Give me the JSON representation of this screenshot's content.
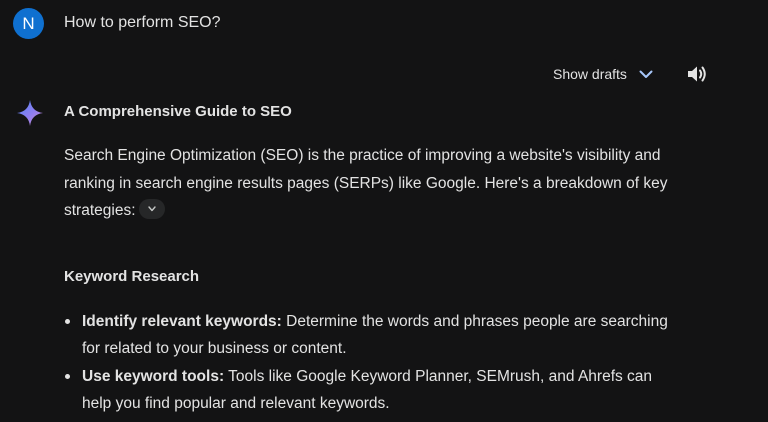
{
  "user": {
    "avatar_initial": "N",
    "prompt": "How to perform SEO?"
  },
  "controls": {
    "show_drafts_label": "Show drafts"
  },
  "response": {
    "heading": "A Comprehensive Guide to SEO",
    "intro": "Search Engine Optimization (SEO) is the practice of improving a website's visibility and ranking in search engine results pages (SERPs) like Google. Here's a breakdown of key strategies:",
    "section_title": "Keyword Research",
    "bullets": [
      {
        "title": "Identify relevant keywords:",
        "text": " Determine the words and phrases people are searching for related to your business or content."
      },
      {
        "title": "Use keyword tools:",
        "text": " Tools like Google Keyword Planner, SEMrush, and Ahrefs can help you find popular and relevant keywords."
      }
    ]
  },
  "colors": {
    "background": "#131314",
    "text": "#e3e3e3",
    "avatar": "#0f70d0"
  },
  "icons": [
    "chevron-down-icon",
    "speaker-icon",
    "gemini-sparkle-icon",
    "sources-chevron-icon"
  ]
}
